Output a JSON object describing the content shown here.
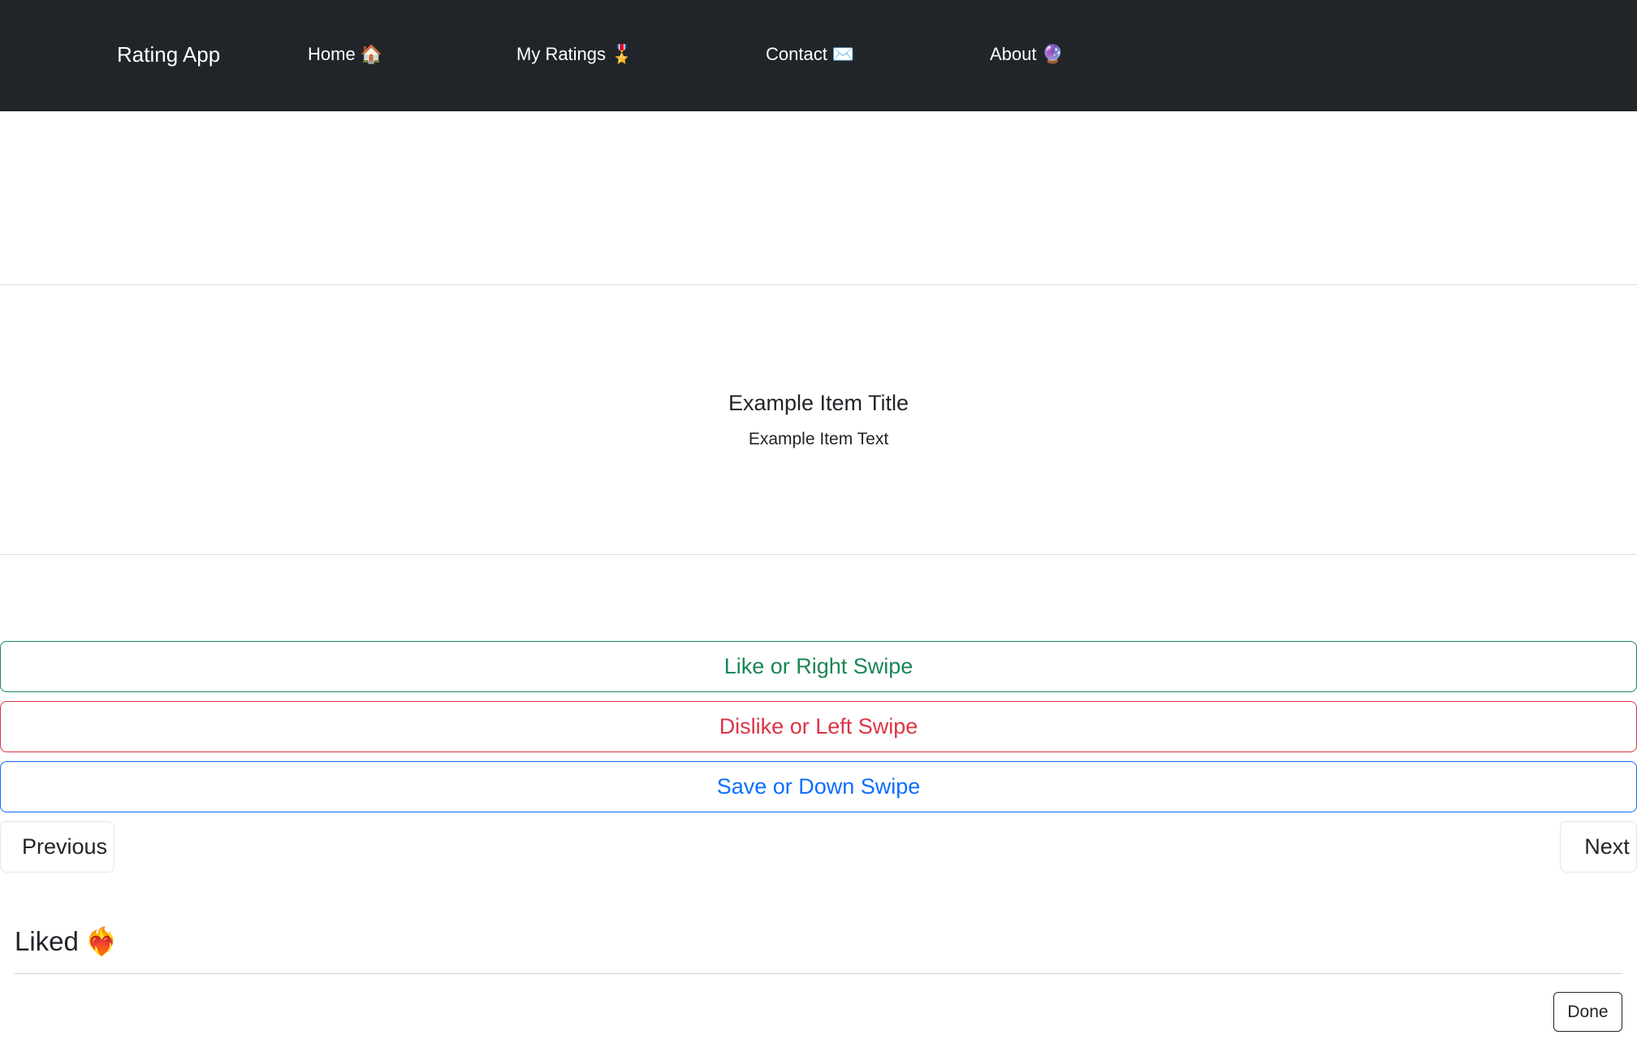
{
  "navbar": {
    "brand": "Rating App",
    "links": [
      {
        "label": "Home",
        "icon": "🏠",
        "icon_name": "house-icon"
      },
      {
        "label": "My Ratings",
        "icon": "🎖️",
        "icon_name": "medal-icon"
      },
      {
        "label": "Contact",
        "icon": "✉️",
        "icon_name": "envelope-icon"
      },
      {
        "label": "About",
        "icon": "🔮",
        "icon_name": "crystal-ball-icon"
      }
    ]
  },
  "card": {
    "title": "Example Item Title",
    "text": "Example Item Text"
  },
  "actions": {
    "like_label": "Like or Right Swipe",
    "dislike_label": "Dislike or Left Swipe",
    "save_label": "Save or Down Swipe"
  },
  "pager": {
    "previous_label": "Previous",
    "next_label": "Next"
  },
  "liked_section": {
    "title": "Liked",
    "icon": "❤️‍🔥",
    "icon_name": "heart-on-fire-icon",
    "done_label": "Done"
  },
  "colors": {
    "navbar_bg": "#212529",
    "success": "#198754",
    "danger": "#dc3545",
    "primary": "#0d6efd"
  }
}
